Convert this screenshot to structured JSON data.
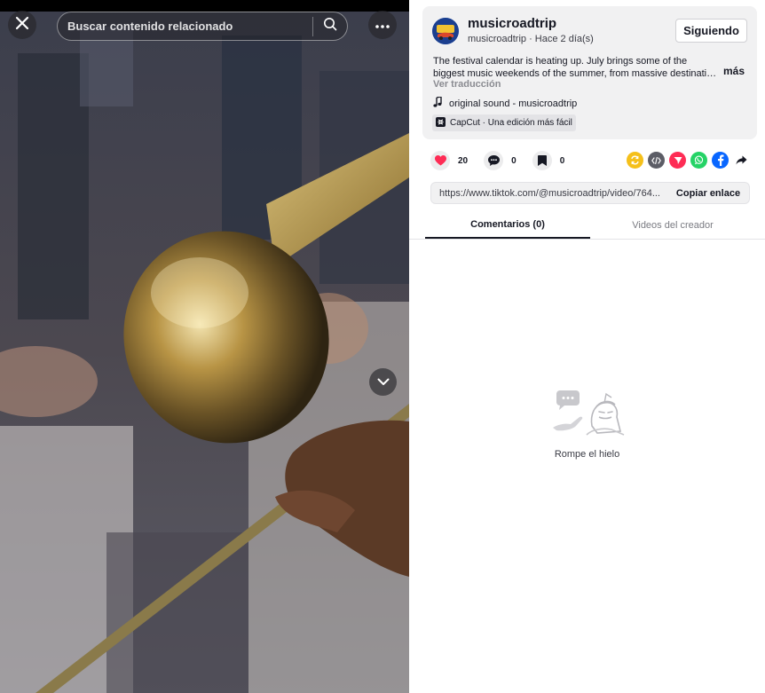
{
  "video": {
    "search_placeholder": "Buscar contenido relacionado",
    "icons": {
      "close": "close-icon",
      "search": "search-icon",
      "more": "ellipsis-icon",
      "down": "chevron-down-icon"
    }
  },
  "author": {
    "name": "musicroadtrip",
    "meta": "musicroadtrip · Hace 2 día(s)",
    "avatar_text": "MUSIC ROADTRIP",
    "follow_label": "Siguiendo"
  },
  "description": {
    "line1": "The festival calendar is heating up. July brings some of the",
    "line2": "biggest music weekends of the summer, from massive destinatio...",
    "more_label": "más",
    "translate_label": "Ver traducción"
  },
  "sound": {
    "label": "original sound - musicroadtrip"
  },
  "capcut": {
    "label": "CapCut · Una edición más fácil"
  },
  "actions": {
    "likes": "20",
    "comments": "0",
    "saves": "0"
  },
  "link": {
    "url": "https://www.tiktok.com/@musicroadtrip/video/764...",
    "copy_label": "Copiar enlace"
  },
  "tabs": {
    "comments": "Comentarios (0)",
    "creator_videos": "Videos del creador"
  },
  "empty_state": {
    "text": "Rompe el hielo"
  },
  "colors": {
    "like": "#fe2c55",
    "repost": "#f5c01a",
    "embed": "#5c5d66",
    "friends": "#fe2c55",
    "whatsapp": "#25d366",
    "facebook": "#0866ff"
  }
}
